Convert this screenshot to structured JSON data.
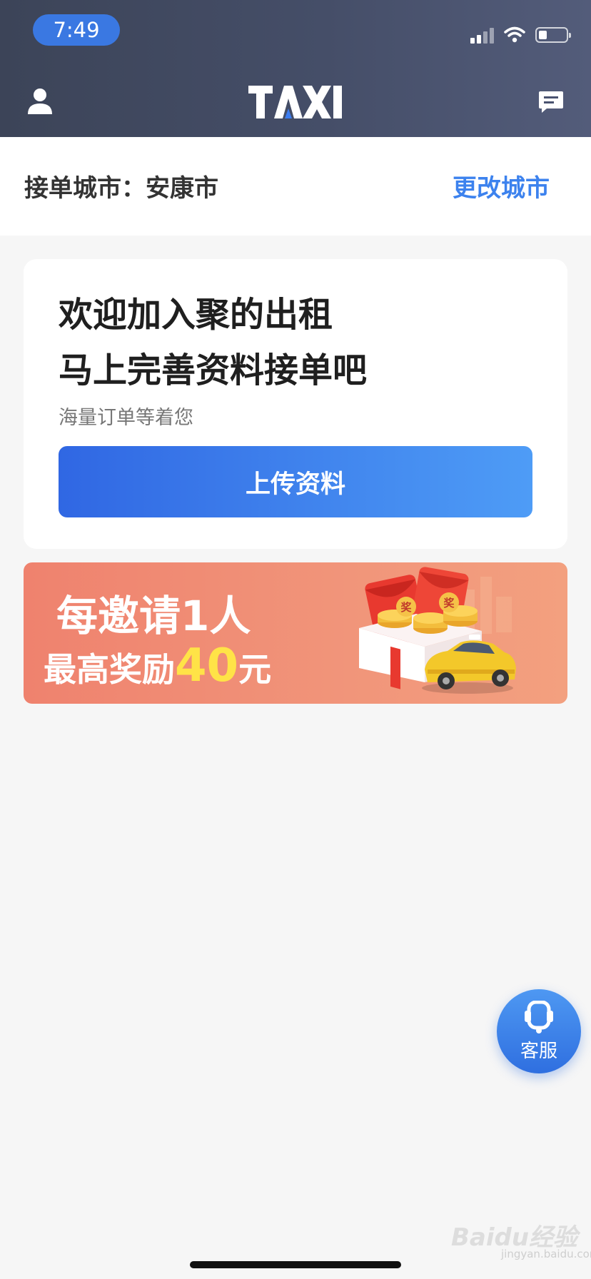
{
  "status_bar": {
    "time": "7:49",
    "battery_level": 0.3
  },
  "header": {
    "logo_text": "TAXI",
    "icons": [
      "user-icon",
      "message-icon"
    ]
  },
  "city_bar": {
    "label": "接单城市：安康市",
    "change_button": "更改城市"
  },
  "welcome_card": {
    "title_line1": "欢迎加入聚的出租",
    "title_line2": "马上完善资料接单吧",
    "subtitle": "海量订单等着您",
    "upload_button": "上传资料"
  },
  "banner": {
    "line1": "每邀请1人",
    "line2_prefix": "最高奖励",
    "amount": "40",
    "unit": "元",
    "coin_text": "奖",
    "colors": {
      "background": "#ef826e",
      "amount": "#ffe347"
    }
  },
  "customer_service": {
    "label": "客服",
    "icon": "headset-icon"
  },
  "watermark": {
    "brand": "Baidu经验",
    "url": "jingyan.baidu.com"
  },
  "colors": {
    "accent": "#3c82ee",
    "header": "#454e68",
    "button_start": "#3067e3",
    "button_end": "#4e9cf6"
  }
}
